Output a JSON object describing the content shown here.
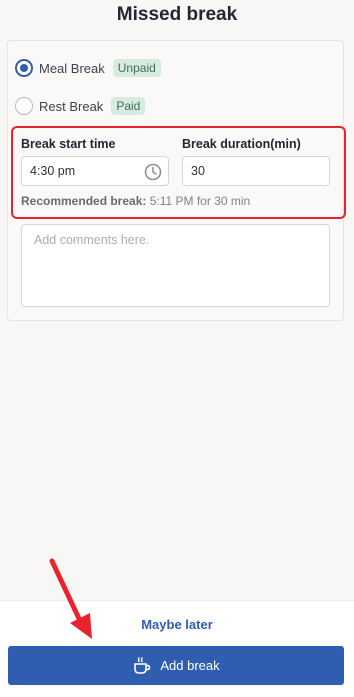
{
  "page": {
    "title": "Missed break"
  },
  "break_types": [
    {
      "label": "Meal Break",
      "badge": "Unpaid",
      "selected": true
    },
    {
      "label": "Rest Break",
      "badge": "Paid",
      "selected": false
    }
  ],
  "start_time": {
    "label": "Break start time",
    "value": "4:30 pm",
    "icon": "clock-icon"
  },
  "duration": {
    "label": "Break duration(min)",
    "value": "30"
  },
  "recommended": {
    "label": "Recommended break:",
    "text": "5:11 PM for 30 min"
  },
  "comments": {
    "placeholder": "Add comments here."
  },
  "footer": {
    "maybe_later": "Maybe later",
    "add_break": "Add break",
    "add_icon": "coffee-cup-icon"
  },
  "colors": {
    "accent": "#2f5eb0",
    "highlight": "#e8232b",
    "badge_bg": "#d8ebe0"
  }
}
